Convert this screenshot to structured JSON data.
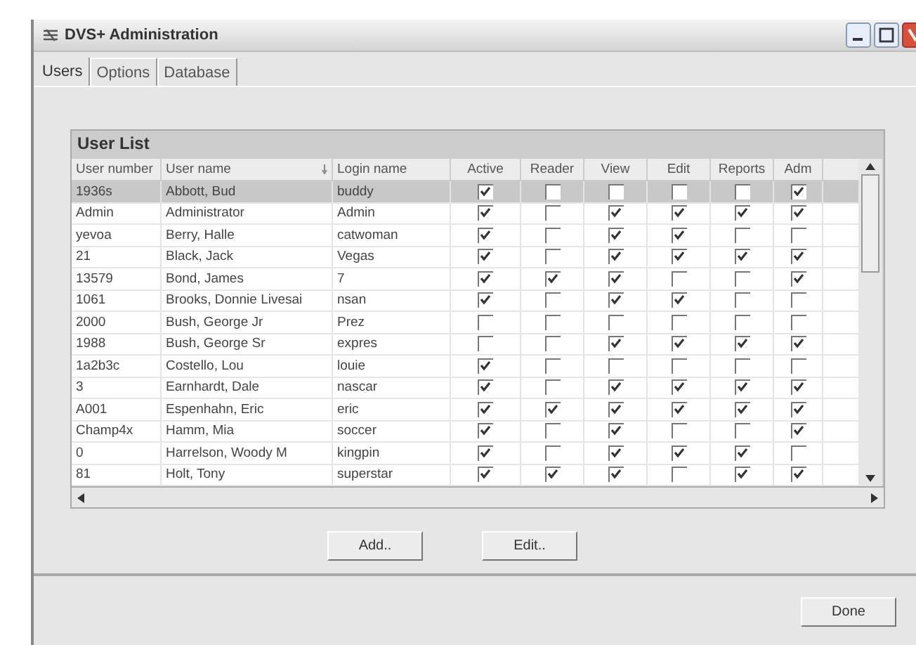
{
  "window": {
    "title": "DVS+ Administration"
  },
  "tabs": [
    {
      "label": "Users",
      "selected": true
    },
    {
      "label": "Options",
      "selected": false
    },
    {
      "label": "Database",
      "selected": false
    }
  ],
  "group": {
    "title": "User List"
  },
  "table": {
    "columns": [
      {
        "label": "User number",
        "kind": "text",
        "sorted": false
      },
      {
        "label": "User name",
        "kind": "text",
        "sorted": true
      },
      {
        "label": "Login name",
        "kind": "text",
        "sorted": false
      },
      {
        "label": "Active",
        "kind": "check",
        "sorted": false
      },
      {
        "label": "Reader",
        "kind": "check",
        "sorted": false
      },
      {
        "label": "View",
        "kind": "check",
        "sorted": false
      },
      {
        "label": "Edit",
        "kind": "check",
        "sorted": false
      },
      {
        "label": "Reports",
        "kind": "check",
        "sorted": false
      },
      {
        "label": "Adm",
        "kind": "check",
        "sorted": false
      }
    ],
    "rows": [
      {
        "cells": [
          "1936s",
          "Abbott, Bud",
          "buddy"
        ],
        "checks": [
          true,
          false,
          false,
          false,
          false,
          true
        ],
        "selected": true
      },
      {
        "cells": [
          "Admin",
          "Administrator",
          "Admin"
        ],
        "checks": [
          true,
          false,
          true,
          true,
          true,
          true
        ],
        "selected": false
      },
      {
        "cells": [
          "yevoa",
          "Berry, Halle",
          "catwoman"
        ],
        "checks": [
          true,
          false,
          true,
          true,
          false,
          false
        ],
        "selected": false
      },
      {
        "cells": [
          "21",
          "Black, Jack",
          "Vegas"
        ],
        "checks": [
          true,
          false,
          true,
          true,
          true,
          true
        ],
        "selected": false
      },
      {
        "cells": [
          "13579",
          "Bond, James",
          "7"
        ],
        "checks": [
          true,
          true,
          true,
          false,
          false,
          true
        ],
        "selected": false
      },
      {
        "cells": [
          "1061",
          "Brooks, Donnie Livesai",
          "nsan"
        ],
        "checks": [
          true,
          false,
          true,
          true,
          false,
          false
        ],
        "selected": false
      },
      {
        "cells": [
          "2000",
          "Bush, George Jr",
          "Prez"
        ],
        "checks": [
          false,
          false,
          false,
          false,
          false,
          false
        ],
        "selected": false
      },
      {
        "cells": [
          "1988",
          "Bush, George Sr",
          "expres"
        ],
        "checks": [
          false,
          false,
          true,
          true,
          true,
          true
        ],
        "selected": false
      },
      {
        "cells": [
          "1a2b3c",
          "Costello, Lou",
          "louie"
        ],
        "checks": [
          true,
          false,
          false,
          false,
          false,
          false
        ],
        "selected": false
      },
      {
        "cells": [
          "3",
          "Earnhardt, Dale",
          "nascar"
        ],
        "checks": [
          true,
          false,
          true,
          true,
          true,
          true
        ],
        "selected": false
      },
      {
        "cells": [
          "A001",
          "Espenhahn, Eric",
          "eric"
        ],
        "checks": [
          true,
          true,
          true,
          true,
          true,
          true
        ],
        "selected": false
      },
      {
        "cells": [
          "Champ4x",
          "Hamm, Mia",
          "soccer"
        ],
        "checks": [
          true,
          false,
          true,
          false,
          false,
          true
        ],
        "selected": false
      },
      {
        "cells": [
          "0",
          "Harrelson, Woody M",
          "kingpin"
        ],
        "checks": [
          true,
          false,
          true,
          true,
          true,
          false
        ],
        "selected": false
      },
      {
        "cells": [
          "81",
          "Holt, Tony",
          "superstar"
        ],
        "checks": [
          true,
          true,
          true,
          false,
          true,
          true
        ],
        "selected": false
      }
    ]
  },
  "buttons": [
    {
      "label": "Add.."
    },
    {
      "label": "Edit.."
    }
  ],
  "footer": {
    "button": "Done"
  }
}
